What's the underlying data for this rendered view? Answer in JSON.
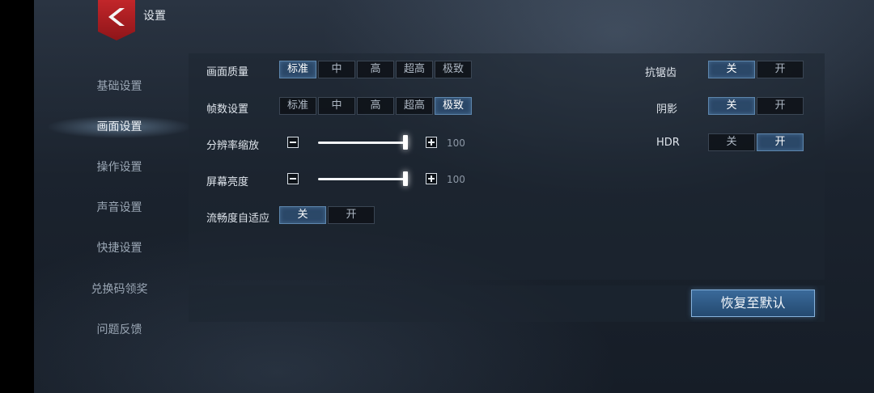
{
  "header": {
    "title": "设置"
  },
  "sidebar": {
    "items": [
      {
        "label": "基础设置"
      },
      {
        "label": "画面设置"
      },
      {
        "label": "操作设置"
      },
      {
        "label": "声音设置"
      },
      {
        "label": "快捷设置"
      },
      {
        "label": "兑换码领奖"
      },
      {
        "label": "问题反馈"
      }
    ],
    "active_index": 1
  },
  "settings": {
    "quality": {
      "label": "画面质量",
      "options": [
        "标准",
        "中",
        "高",
        "超高",
        "极致"
      ],
      "selected": "标准"
    },
    "framerate": {
      "label": "帧数设置",
      "options": [
        "标准",
        "中",
        "高",
        "超高",
        "极致"
      ],
      "selected": "极致"
    },
    "resolution": {
      "label": "分辨率缩放",
      "value": "100",
      "level": 1.0
    },
    "brightness": {
      "label": "屏幕亮度",
      "value": "100",
      "level": 1.0
    },
    "adaptive": {
      "label": "流畅度自适应",
      "options": [
        "关",
        "开"
      ],
      "selected": "关"
    },
    "antialias": {
      "label": "抗锯齿",
      "options": [
        "关",
        "开"
      ],
      "selected": "关"
    },
    "shadow": {
      "label": "阴影",
      "options": [
        "关",
        "开"
      ],
      "selected": "关"
    },
    "hdr": {
      "label": "HDR",
      "options": [
        "关",
        "开"
      ],
      "selected": "开"
    }
  },
  "reset_label": "恢复至默认",
  "colors": {
    "accent": "#2b4868",
    "brand_red": "#c2262a"
  }
}
